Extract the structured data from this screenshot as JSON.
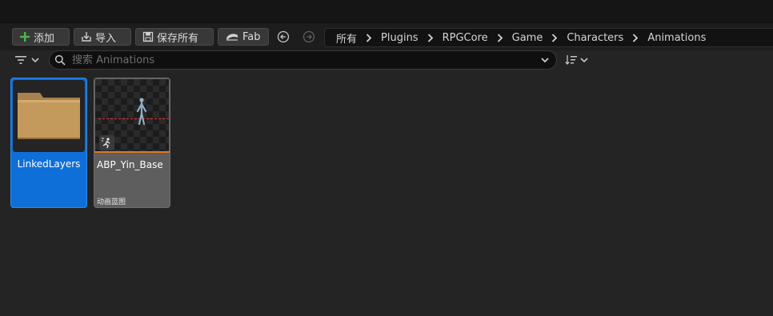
{
  "toolbar": {
    "add_label": "添加",
    "import_label": "导入",
    "save_all_label": "保存所有",
    "fab_label": "Fab"
  },
  "breadcrumb": {
    "items": [
      "所有",
      "Plugins",
      "RPGCore",
      "Game",
      "Characters",
      "Animations"
    ]
  },
  "search": {
    "placeholder": "搜索 Animations",
    "value": ""
  },
  "assets": [
    {
      "name": "LinkedLayers",
      "kind": "folder",
      "selected": true
    },
    {
      "name": "ABP_Yin_Base",
      "kind": "asset",
      "type_label": "动画蓝图"
    }
  ],
  "colors": {
    "selection": "#0f6fd8",
    "folder": "#c49a5c",
    "anim_blueprint_accent": "#e0791e",
    "add_icon": "#4fb34f"
  }
}
